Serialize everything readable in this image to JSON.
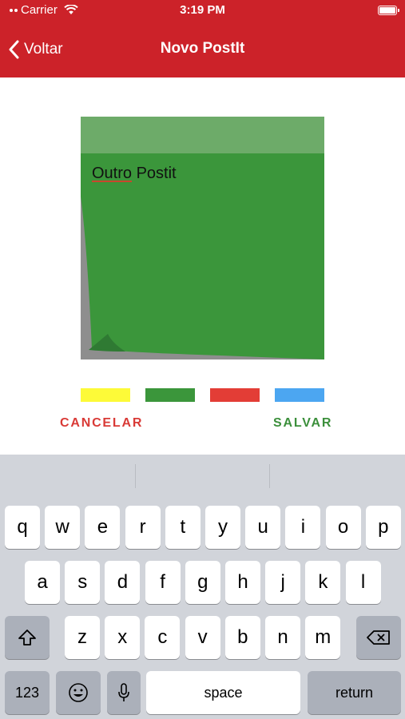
{
  "status_bar": {
    "carrier": "Carrier",
    "time": "3:19 PM"
  },
  "nav": {
    "back_label": "Voltar",
    "title": "Novo PostIt"
  },
  "postit": {
    "text_underlined": "Outro",
    "text_rest": " Postit",
    "color": "#3b963b",
    "header_color": "#6dab69"
  },
  "swatches": [
    {
      "name": "yellow",
      "color": "#fdfa38"
    },
    {
      "name": "green",
      "color": "#3b963b"
    },
    {
      "name": "red",
      "color": "#e33d36"
    },
    {
      "name": "blue",
      "color": "#4ca6f1"
    }
  ],
  "actions": {
    "cancel": "CANCELAR",
    "save": "SALVAR"
  },
  "keyboard": {
    "row1": [
      "q",
      "w",
      "e",
      "r",
      "t",
      "y",
      "u",
      "i",
      "o",
      "p"
    ],
    "row2": [
      "a",
      "s",
      "d",
      "f",
      "g",
      "h",
      "j",
      "k",
      "l"
    ],
    "row3": [
      "z",
      "x",
      "c",
      "v",
      "b",
      "n",
      "m"
    ],
    "numbers_key": "123",
    "space_key": "space",
    "return_key": "return"
  }
}
